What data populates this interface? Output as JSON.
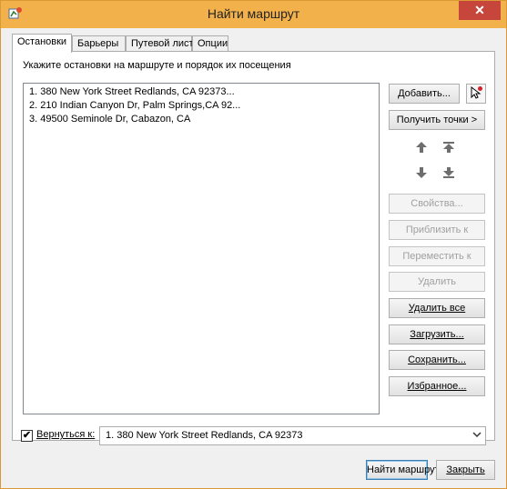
{
  "window": {
    "title": "Найти маршрут",
    "close_label": "✕"
  },
  "tabs": [
    {
      "label": "Остановки",
      "active": true
    },
    {
      "label": "Барьеры",
      "active": false
    },
    {
      "label": "Путевой лист",
      "active": false
    },
    {
      "label": "Опции",
      "active": false
    }
  ],
  "stops_tab": {
    "instruction": "Укажите остановки на маршруте и порядок их посещения",
    "stops": [
      "1.  380 New York Street Redlands, CA 92373...",
      "2. 210 Indian Canyon Dr, Palm Springs,CA 92...",
      "3. 49500 Seminole Dr, Cabazon, CA"
    ],
    "buttons": {
      "add": "Добавить...",
      "get_points": "Получить точки",
      "get_points_arrow": ">",
      "properties": "Свойства...",
      "zoom_to": "Приблизить к",
      "move_to": "Переместить к",
      "delete": "Удалить",
      "delete_all": "Удалить все",
      "load": "Загрузить...",
      "save": "Сохранить...",
      "favorites": "Избранное..."
    },
    "icons": {
      "pointer": "cursor-pointer-red-dot-icon",
      "move_up": "arrow-up-icon",
      "move_to_top": "arrow-to-top-icon",
      "move_down": "arrow-down-icon",
      "move_to_bottom": "arrow-to-bottom-icon"
    }
  },
  "footer": {
    "return_checkbox_checked": true,
    "return_label": "Вернуться к:",
    "return_value": "1. 380 New York Street Redlands, CA 92373"
  },
  "actions": {
    "find_route": "Найти маршрут",
    "close": "Закрыть"
  },
  "colors": {
    "title_bar": "#f2b14a",
    "close_button": "#c7463b",
    "default_button_border": "#3c7fb1"
  }
}
